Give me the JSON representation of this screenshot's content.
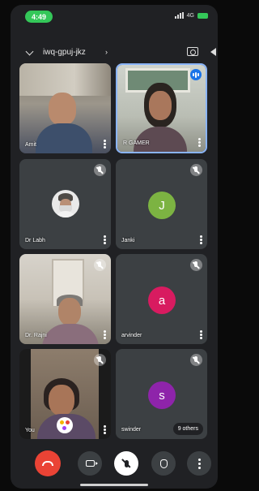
{
  "status_bar": {
    "time": "4:49",
    "network": "4G"
  },
  "header": {
    "meeting_code": "iwq-gpuj-jkz",
    "meeting_code_arrow": "›"
  },
  "participants": [
    {
      "name": "Amit",
      "video": true,
      "speaking": false,
      "muted": false
    },
    {
      "name": "R GAMER",
      "video": true,
      "speaking": true,
      "muted": false
    },
    {
      "name": "Dr Labh",
      "video": false,
      "avatar_photo": true,
      "muted": true
    },
    {
      "name": "Janki",
      "video": false,
      "initial": "J",
      "avatar_color": "#7cb342",
      "muted": true
    },
    {
      "name": "Dr. Rajni",
      "video": true,
      "muted": true
    },
    {
      "name": "arvinder",
      "video": false,
      "initial": "a",
      "avatar_color": "#d81b60",
      "muted": true
    },
    {
      "name": "You",
      "video": true,
      "muted": true
    },
    {
      "name": "swinder",
      "video": false,
      "initial": "s",
      "avatar_color": "#8e24aa",
      "muted": true
    }
  ],
  "others_label": "9 others",
  "controls": {
    "end_call": "end-call",
    "camera": "camera",
    "mic": "mic-off",
    "raise_hand": "raise-hand",
    "more": "more-options"
  },
  "colors": {
    "background": "#202124",
    "tile": "#3c4043",
    "speaking_border": "#8ab4f8",
    "end_call": "#ea4335",
    "time_pill": "#34c759"
  }
}
